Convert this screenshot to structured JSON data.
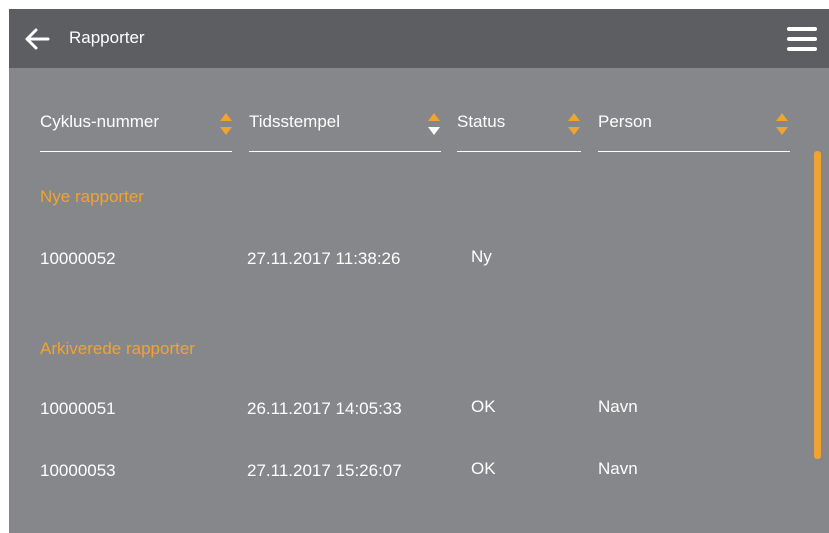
{
  "header": {
    "title": "Rapporter",
    "back_icon": "arrow-left-icon",
    "menu_icon": "hamburger-menu-icon"
  },
  "columns": [
    {
      "label": "Cyklus-nummer",
      "sort": "none"
    },
    {
      "label": "Tidsstempel",
      "sort": "descending"
    },
    {
      "label": "Status",
      "sort": "none"
    },
    {
      "label": "Person",
      "sort": "none"
    }
  ],
  "sections": [
    {
      "title": "Nye rapporter",
      "rows": [
        {
          "cycle": "10000052",
          "timestamp": "27.11.2017 11:38:26",
          "status": "Ny",
          "person": ""
        }
      ]
    },
    {
      "title": "Arkiverede rapporter",
      "rows": [
        {
          "cycle": "10000051",
          "timestamp": "26.11.2017 14:05:33",
          "status": "OK",
          "person": "Navn"
        },
        {
          "cycle": "10000053",
          "timestamp": "27.11.2017 15:26:07",
          "status": "OK",
          "person": "Navn"
        }
      ]
    }
  ],
  "colors": {
    "background": "#86878a",
    "header": "#5d5e61",
    "accent": "#f0a330",
    "text": "#ffffff"
  }
}
